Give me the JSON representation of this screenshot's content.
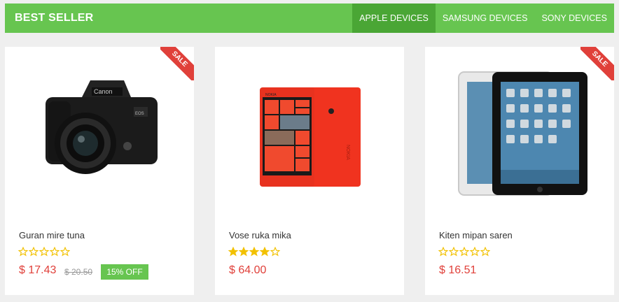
{
  "header": {
    "title": "BEST SELLER",
    "tabs": [
      {
        "label": "APPLE DEVICES",
        "active": true
      },
      {
        "label": "SAMSUNG DEVICES",
        "active": false
      },
      {
        "label": "SONY DEVICES",
        "active": false
      }
    ]
  },
  "colors": {
    "accent": "#67c550",
    "accent_dark": "#4aa635",
    "price": "#e0403a",
    "sale_ribbon": "#e0403a",
    "star": "#f2c100"
  },
  "products": [
    {
      "name": "Guran mire tuna",
      "image": "dslr-camera-image",
      "ribbon": "SALE",
      "rating": 0,
      "max_rating": 5,
      "price": "$ 17.43",
      "old_price": "$ 20.50",
      "discount": "15% OFF"
    },
    {
      "name": "Vose ruka mika",
      "image": "red-smartphone-image",
      "rating": 4,
      "max_rating": 5,
      "price": "$ 64.00"
    },
    {
      "name": "Kiten mipan saren",
      "image": "tablet-image",
      "ribbon": "SALE",
      "rating": 0,
      "max_rating": 5,
      "price": "$ 16.51"
    }
  ]
}
